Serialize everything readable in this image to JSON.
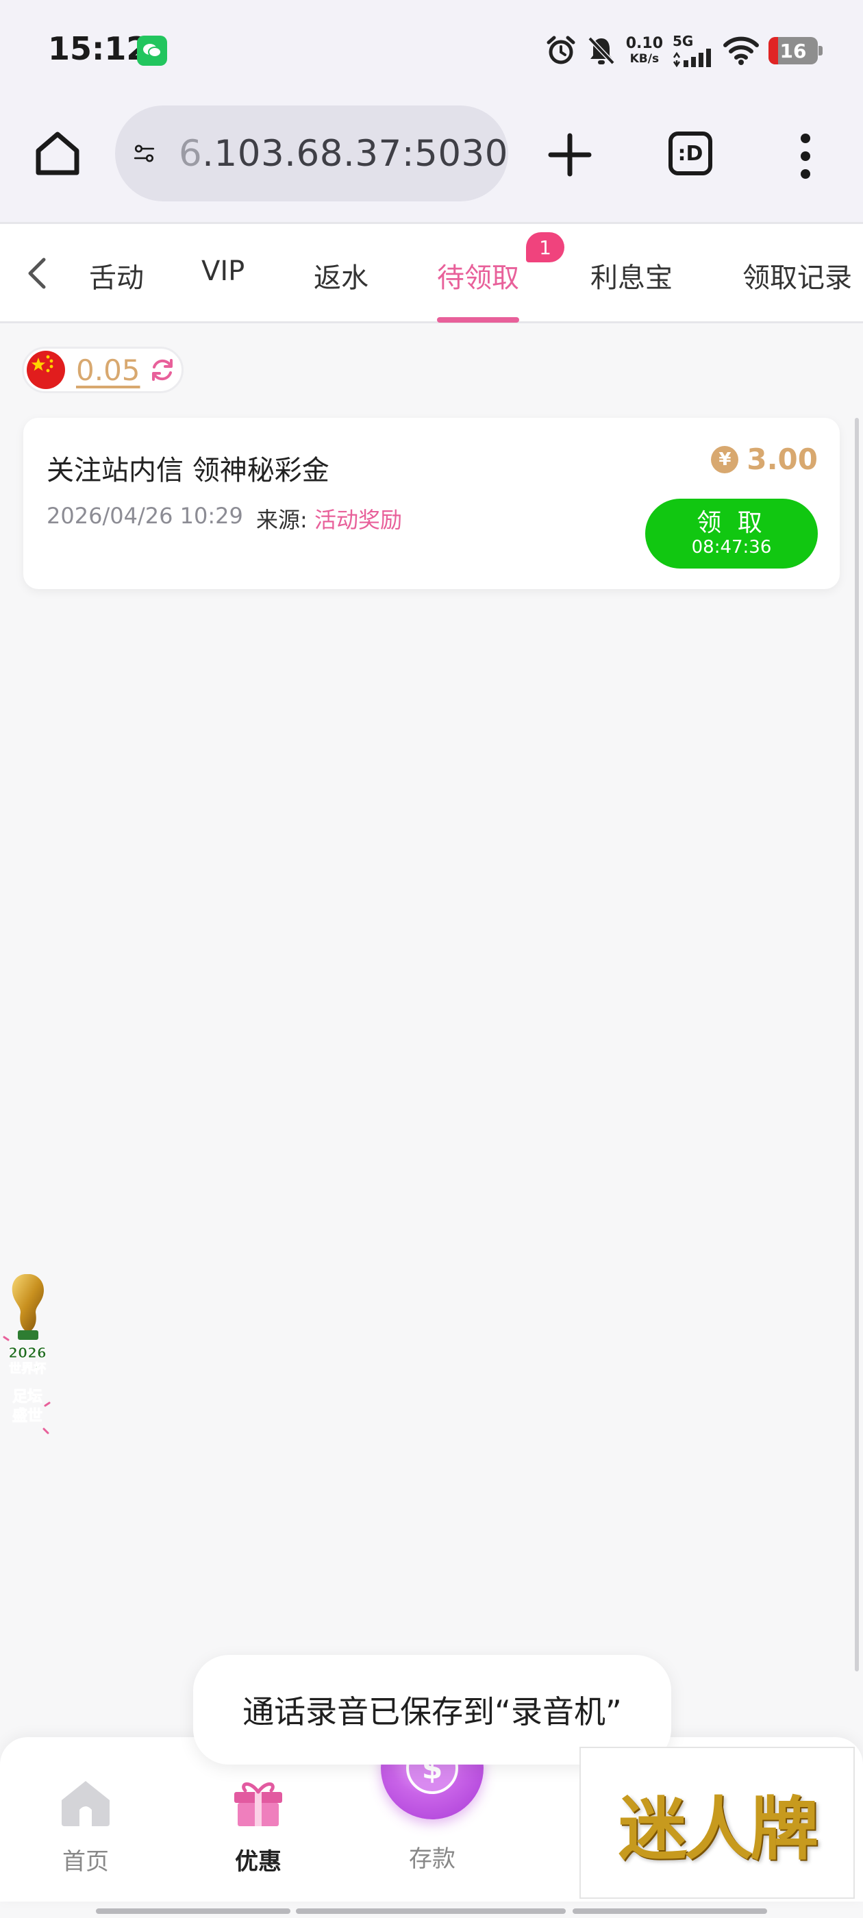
{
  "status_bar": {
    "time": "15:12",
    "net_speed_value": "0.10",
    "net_speed_unit": "KB/s",
    "network_type": "5G",
    "battery_level": "16"
  },
  "browser": {
    "url_prefix_faded": "6",
    "url_main": ".103.68.37:5030",
    "tabs_icon_text": ":D"
  },
  "tabs": {
    "items": [
      {
        "label": "活动",
        "visible_label": "舌动"
      },
      {
        "label": "VIP"
      },
      {
        "label": "返水"
      },
      {
        "label": "待领取",
        "active": true,
        "badge": "1"
      },
      {
        "label": "利息宝"
      },
      {
        "label": "领取记录"
      }
    ]
  },
  "balance": {
    "amount": "0.05",
    "flag": "china-flag-icon"
  },
  "reward_card": {
    "title": "关注站内信 领神秘彩金",
    "date": "2026/04/26 10:29",
    "source_label": "来源: ",
    "source_value": "活动奖励",
    "currency_symbol": "¥",
    "amount": "3.00",
    "claim_label": "领 取",
    "countdown": "08:47:36"
  },
  "floating_widget": {
    "year": "2026",
    "line1": "世界杯",
    "line2": "足坛",
    "line3": "盛世"
  },
  "toast": {
    "message": "通话录音已保存到“录音机”"
  },
  "bottom_nav": {
    "items": [
      {
        "label": "首页"
      },
      {
        "label": "优惠",
        "active": true
      },
      {
        "label": "存款"
      }
    ]
  },
  "ad": {
    "text": "迷人牌"
  },
  "colors": {
    "accent_pink": "#e8609a",
    "gold": "#d8a86f",
    "claim_green": "#11c711",
    "badge_pink": "#f0437d"
  }
}
